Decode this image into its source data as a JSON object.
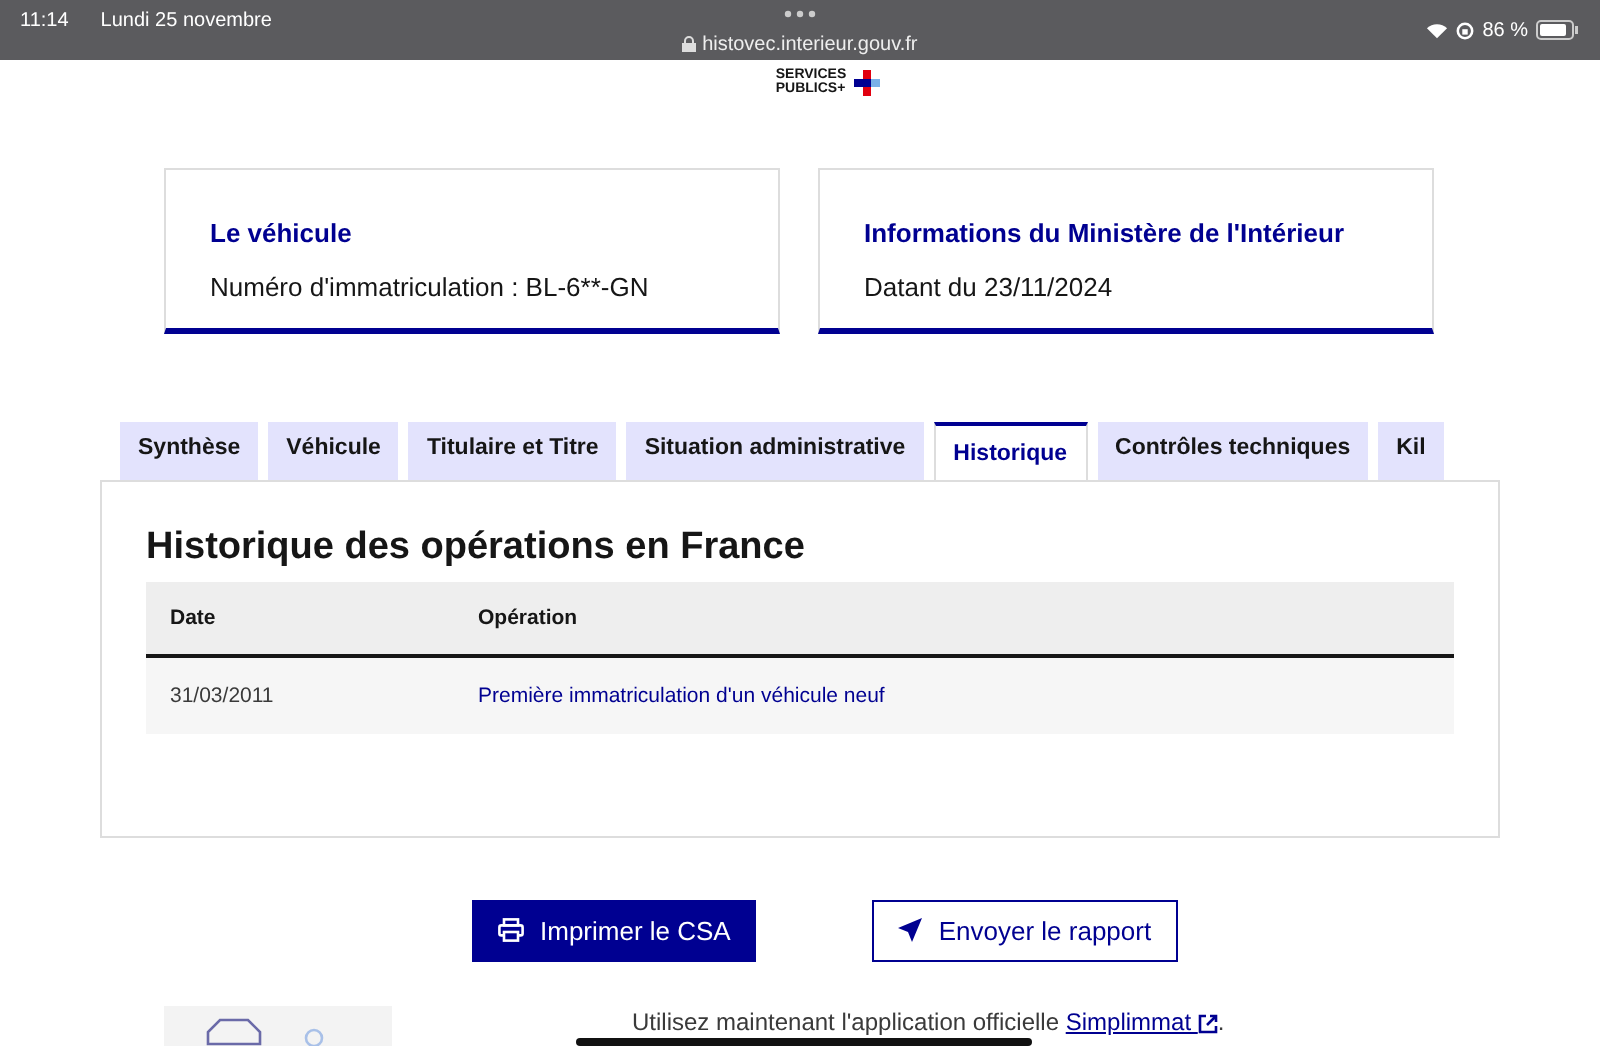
{
  "status_bar": {
    "time": "11:14",
    "date": "Lundi 25 novembre",
    "url": "histovec.interieur.gouv.fr",
    "battery_text": "86 %"
  },
  "logo": {
    "line_1": "SERVICES",
    "line_2": "PUBLICS+"
  },
  "cards": [
    {
      "title": "Le véhicule",
      "text": "Numéro d'immatriculation : BL-6**-GN"
    },
    {
      "title": "Informations du Ministère de l'Intérieur",
      "text": "Datant du 23/11/2024"
    }
  ],
  "tabs": [
    {
      "label": "Synthèse",
      "selected": false
    },
    {
      "label": "Véhicule",
      "selected": false
    },
    {
      "label": "Titulaire et Titre",
      "selected": false
    },
    {
      "label": "Situation administrative",
      "selected": false
    },
    {
      "label": "Historique",
      "selected": true
    },
    {
      "label": "Contrôles techniques",
      "selected": false
    },
    {
      "label": "Kil",
      "selected": false
    }
  ],
  "panel": {
    "title": "Historique des opérations en France",
    "table": {
      "columns": [
        "Date",
        "Opération"
      ],
      "rows": [
        [
          "31/03/2011",
          "Première immatriculation d'un véhicule neuf"
        ]
      ]
    }
  },
  "buttons": [
    {
      "label": "Imprimer le CSA",
      "kind": "primary"
    },
    {
      "label": "Envoyer le rapport",
      "kind": "secondary"
    }
  ],
  "footer": {
    "text": "Utilisez maintenant l'application officielle",
    "link": "Simplimmat",
    "end": "."
  }
}
